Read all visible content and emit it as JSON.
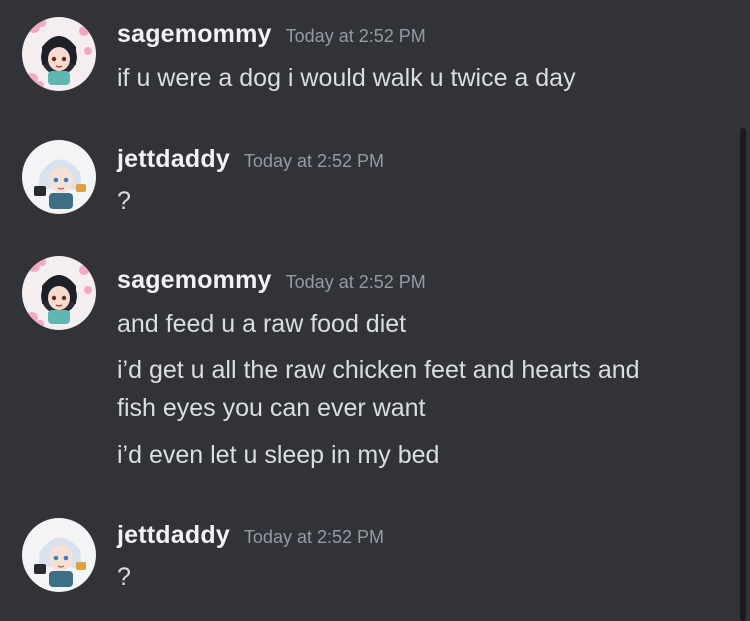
{
  "messages": [
    {
      "author": "sagemommy",
      "timestamp": "Today at 2:52 PM",
      "avatar_icon": "anime-girl-cherry-blossom-avatar",
      "lines": [
        "if u were a dog i would walk u twice a day"
      ]
    },
    {
      "author": "jettdaddy",
      "timestamp": "Today at 2:52 PM",
      "avatar_icon": "anime-white-hair-avatar",
      "lines": [
        "?"
      ]
    },
    {
      "author": "sagemommy",
      "timestamp": "Today at 2:52 PM",
      "avatar_icon": "anime-girl-cherry-blossom-avatar",
      "lines": [
        "and feed u a raw food diet",
        "i’d get u all the raw chicken feet and hearts and",
        "fish eyes you can ever want",
        "i’d even let u sleep in my bed"
      ]
    },
    {
      "author": "jettdaddy",
      "timestamp": "Today at 2:52 PM",
      "avatar_icon": "anime-white-hair-avatar",
      "lines": [
        "?"
      ]
    }
  ],
  "colors": {
    "background": "#313338",
    "author": "#f2f3f5",
    "timestamp": "#949ba4",
    "text": "#dbdee1"
  }
}
